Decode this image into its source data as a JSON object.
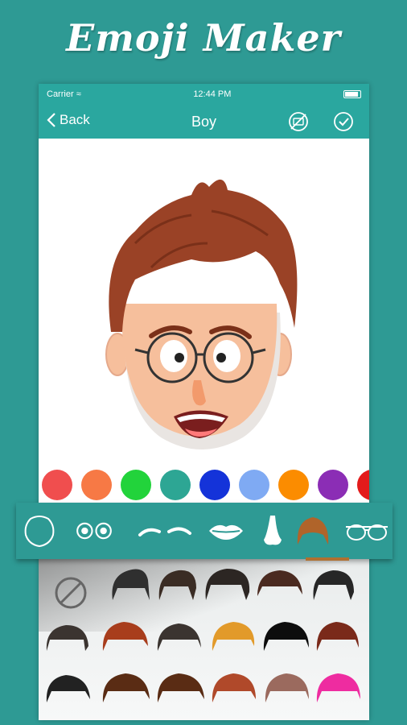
{
  "promo": {
    "title": "Emoji Maker"
  },
  "status_bar": {
    "carrier": "Carrier",
    "time": "12:44 PM"
  },
  "nav": {
    "back_label": "Back",
    "title": "Boy"
  },
  "colors": {
    "nav_bg": "#2aa79f",
    "page_bg": "#2e9a94",
    "skin": "#f6bf9c",
    "hair": "#9a4226"
  },
  "palette": {
    "swatches": [
      "#f04e4e",
      "#f77945",
      "#22d33b",
      "#2da694",
      "#1433d9",
      "#7faaf3",
      "#fb8c00",
      "#8b2db5",
      "#e31b1b"
    ]
  },
  "toolbar": {
    "tools": [
      "face-shape",
      "eyes",
      "eyebrows",
      "lips",
      "nose",
      "hair",
      "glasses"
    ],
    "selected": "hair"
  },
  "hair_styles": {
    "row1": [
      "none",
      "#2f2f2f",
      "#3a2c24",
      "#2c2623",
      "#4a2a20",
      "#262626"
    ],
    "row2": [
      "#3b3430",
      "#a83d1c",
      "#3b3430",
      "#e29a2a",
      "#0d0d0d",
      "#7a2a1a"
    ],
    "row3": [
      "#222222",
      "#5a2c14",
      "#5a2c14",
      "#b0492a",
      "#9b6a5e",
      "#ee2ca0"
    ]
  }
}
